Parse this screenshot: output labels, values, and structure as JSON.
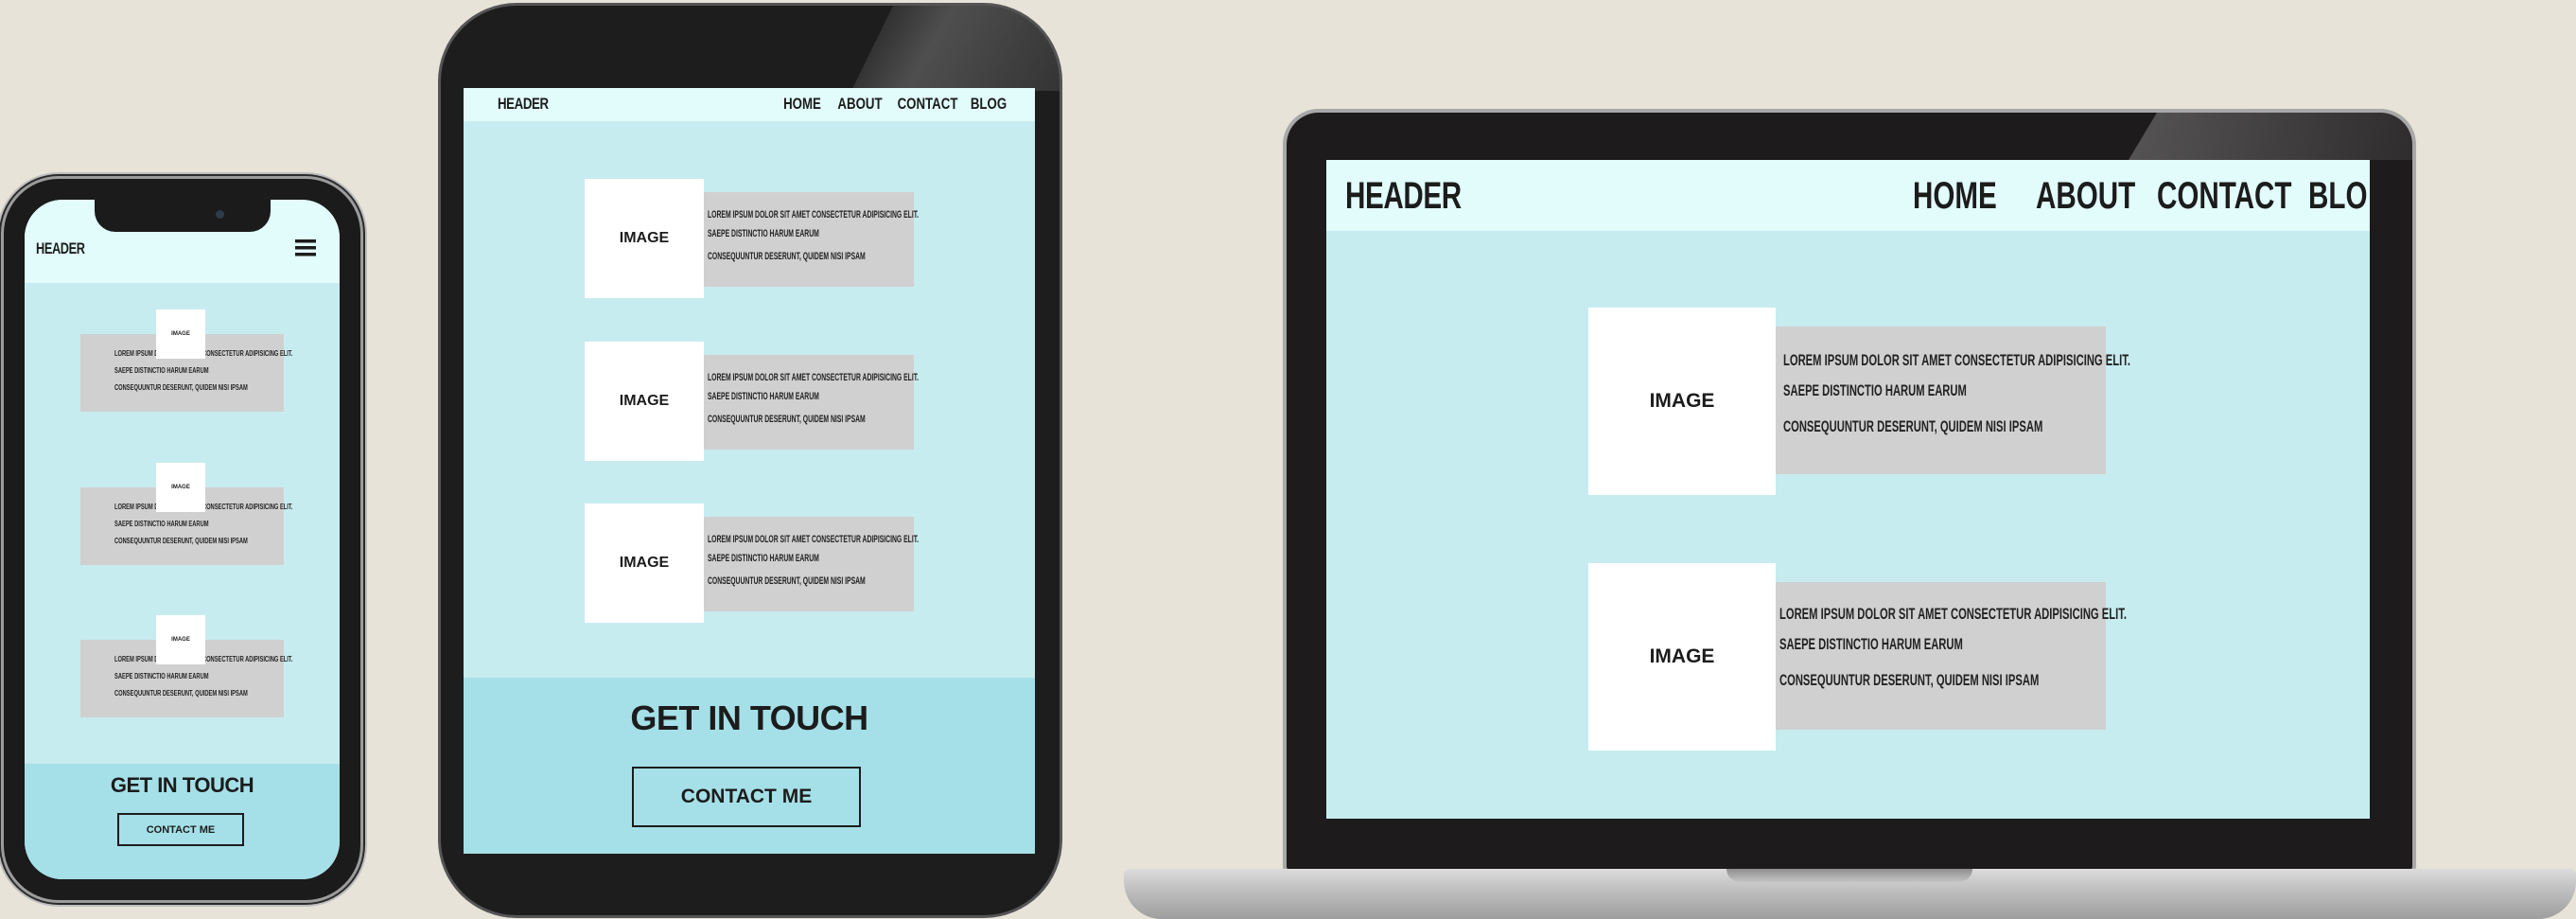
{
  "phone": {
    "header": "HEADER",
    "menu_icon": "hamburger-menu-icon",
    "cards": [
      {
        "image": "IMAGE",
        "line1": "LOREM IPSUM DOLOR SIT AMET CONSECTETUR ADIPISICING ELIT.",
        "line2": "SAEPE DISTINCTIO HARUM EARUM",
        "line3": "CONSEQUUNTUR DESERUNT, QUIDEM NISI IPSAM"
      },
      {
        "image": "IMAGE",
        "line1": "LOREM IPSUM DOLOR SIT AMET CONSECTETUR ADIPISICING ELIT.",
        "line2": "SAEPE DISTINCTIO HARUM EARUM",
        "line3": "CONSEQUUNTUR DESERUNT, QUIDEM NISI IPSAM"
      },
      {
        "image": "IMAGE",
        "line1": "LOREM IPSUM DOLOR SIT AMET CONSECTETUR ADIPISICING ELIT.",
        "line2": "SAEPE DISTINCTIO HARUM EARUM",
        "line3": "CONSEQUUNTUR DESERUNT, QUIDEM NISI IPSAM"
      }
    ],
    "footer_title": "GET IN TOUCH",
    "footer_button": "CONTACT ME"
  },
  "tablet": {
    "header": "HEADER",
    "nav": [
      "HOME",
      "ABOUT",
      "CONTACT",
      "BLOG"
    ],
    "cards": [
      {
        "image": "IMAGE",
        "line1": "LOREM IPSUM DOLOR SIT AMET CONSECTETUR ADIPISICING ELIT.",
        "line2": "SAEPE DISTINCTIO HARUM EARUM",
        "line3": "CONSEQUUNTUR DESERUNT, QUIDEM NISI IPSAM"
      },
      {
        "image": "IMAGE",
        "line1": "LOREM IPSUM DOLOR SIT AMET CONSECTETUR ADIPISICING ELIT.",
        "line2": "SAEPE DISTINCTIO HARUM EARUM",
        "line3": "CONSEQUUNTUR DESERUNT, QUIDEM NISI IPSAM"
      },
      {
        "image": "IMAGE",
        "line1": "LOREM IPSUM DOLOR SIT AMET CONSECTETUR ADIPISICING ELIT.",
        "line2": "SAEPE DISTINCTIO HARUM EARUM",
        "line3": "CONSEQUUNTUR DESERUNT, QUIDEM NISI IPSAM"
      }
    ],
    "footer_title": "GET IN TOUCH",
    "footer_button": "CONTACT ME"
  },
  "laptop": {
    "header": "HEADER",
    "nav": [
      "HOME",
      "ABOUT",
      "CONTACT",
      "BLO"
    ],
    "cards": [
      {
        "image": "IMAGE",
        "line1": "LOREM IPSUM DOLOR SIT AMET CONSECTETUR ADIPISICING ELIT.",
        "line2": "SAEPE DISTINCTIO HARUM EARUM",
        "line3": "CONSEQUUNTUR DESERUNT, QUIDEM NISI IPSAM"
      },
      {
        "image": "IMAGE",
        "line1": "LOREM IPSUM DOLOR SIT AMET CONSECTETUR ADIPISICING ELIT.",
        "line2": "SAEPE DISTINCTIO HARUM EARUM",
        "line3": "CONSEQUUNTUR DESERUNT, QUIDEM NISI IPSAM"
      }
    ]
  },
  "colors": {
    "background": "#e7e3d9",
    "header_bg": "#e2fbfb",
    "page_bg": "#c7ecf0",
    "footer_bg": "#a5e0e8",
    "card_text_bg": "#d0d0d0",
    "device_frame": "#1d1d1d"
  }
}
